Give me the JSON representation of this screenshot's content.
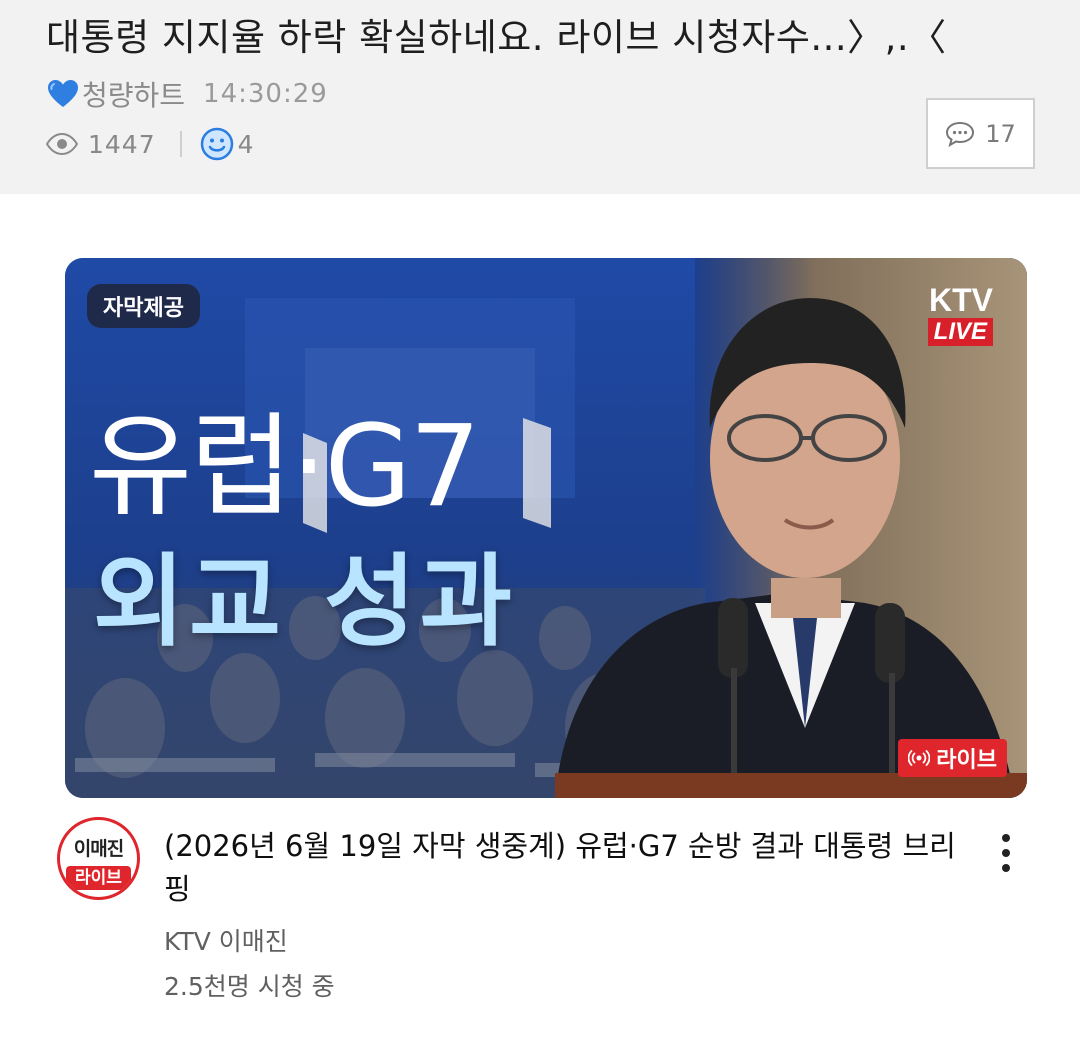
{
  "post": {
    "title": "대통령 지지율 하락 확실하네요. 라이브 시청자수...〉,.〈",
    "author": "청량하트",
    "time": "14:30:29",
    "views": "1447",
    "likes": "4",
    "comments": "17",
    "icons": {
      "author_badge": "blue-heart-icon",
      "views": "eye-icon",
      "likes": "smiley-icon",
      "comments": "speech-bubble-icon"
    }
  },
  "video": {
    "thumbnail": {
      "subtitle_badge": "자막제공",
      "headline_line1": "유럽·G7",
      "headline_line2": "외교 성과",
      "logo": "KTV",
      "logo_live": "LIVE",
      "live_badge": "라이브"
    },
    "channel_avatar": {
      "top_text": "이매진",
      "bottom_text": "라이브"
    },
    "title": "(2026년 6월 19일 자막 생중계) 유럽·G7 순방 결과 대통령 브리핑",
    "channel": "KTV 이매진",
    "viewers": "2.5천명 시청 중",
    "colors": {
      "live_red": "#e0262d",
      "thumb_blue": "#1a3f8f",
      "headline_light_blue": "#b8e4ff"
    }
  }
}
